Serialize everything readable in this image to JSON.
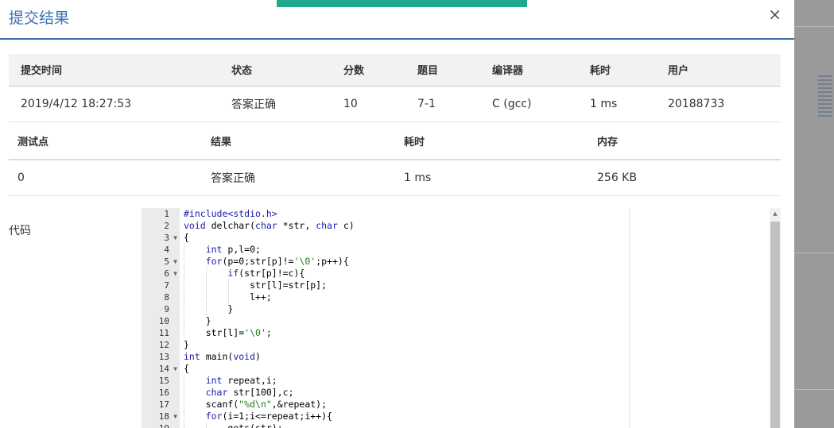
{
  "modal": {
    "title": "提交结果",
    "close_label": "×"
  },
  "summary": {
    "headers": [
      "提交时间",
      "状态",
      "分数",
      "题目",
      "编译器",
      "耗时",
      "用户"
    ],
    "row": {
      "time": "2019/4/12 18:27:53",
      "status": "答案正确",
      "score": "10",
      "problem": "7-1",
      "compiler": "C (gcc)",
      "elapsed": "1 ms",
      "user": "20188733"
    }
  },
  "tests": {
    "headers": [
      "测试点",
      "结果",
      "耗时",
      "内存"
    ],
    "rows": [
      {
        "point": "0",
        "result": "答案正确",
        "elapsed": "1 ms",
        "memory": "256 KB"
      }
    ]
  },
  "code_label": "代码",
  "code": {
    "lines": [
      "#include<stdio.h>",
      "void delchar(char *str, char c)",
      "{",
      "    int p,l=0;",
      "    for(p=0;str[p]!='\\0';p++){",
      "        if(str[p]!=c){",
      "            str[l]=str[p];",
      "            l++;",
      "        }",
      "    }",
      "    str[l]='\\0';",
      "}",
      "int main(void)",
      "{",
      "    int repeat,i;",
      "    char str[100],c;",
      "    scanf(\"%d\\n\",&repeat);",
      "    for(i=1;i<=repeat;i++){",
      "        gets(str);"
    ],
    "fold_lines": [
      3,
      5,
      6,
      14,
      18
    ]
  },
  "colors": {
    "accent": "#3c72b4",
    "status_ok": "#d9433a",
    "toast": "#1fa98a"
  }
}
